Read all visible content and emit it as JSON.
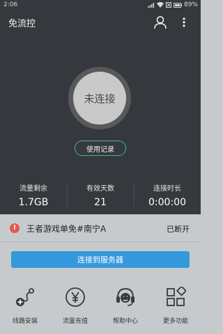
{
  "status_bar": {
    "time": "2:06",
    "battery": "89%"
  },
  "app_bar": {
    "title": "免流控"
  },
  "main": {
    "connect_state": "未连接",
    "usage_record_label": "使用记录",
    "stats": [
      {
        "label": "流量剩余",
        "value": "1.7GB"
      },
      {
        "label": "有效天数",
        "value": "21"
      },
      {
        "label": "连接时长",
        "value": "0:00:00"
      }
    ]
  },
  "notice": {
    "server_name": "王者游戏单免#南宁A",
    "status": "已断开",
    "alert_symbol": "!"
  },
  "connect_button": {
    "label": "连接到服务器"
  },
  "bottom_nav": [
    {
      "label": "线路安装",
      "icon": "route-install-icon"
    },
    {
      "label": "流量充值",
      "icon": "yuan-recharge-icon"
    },
    {
      "label": "帮助中心",
      "icon": "headset-help-icon"
    },
    {
      "label": "更多功能",
      "icon": "grid-more-icon"
    }
  ],
  "colors": {
    "dark_bg": "#35383d",
    "light_bg": "#c7cacd",
    "accent_green": "#3fb89f",
    "accent_blue": "#3598dc",
    "alert_red": "#e4574f"
  }
}
